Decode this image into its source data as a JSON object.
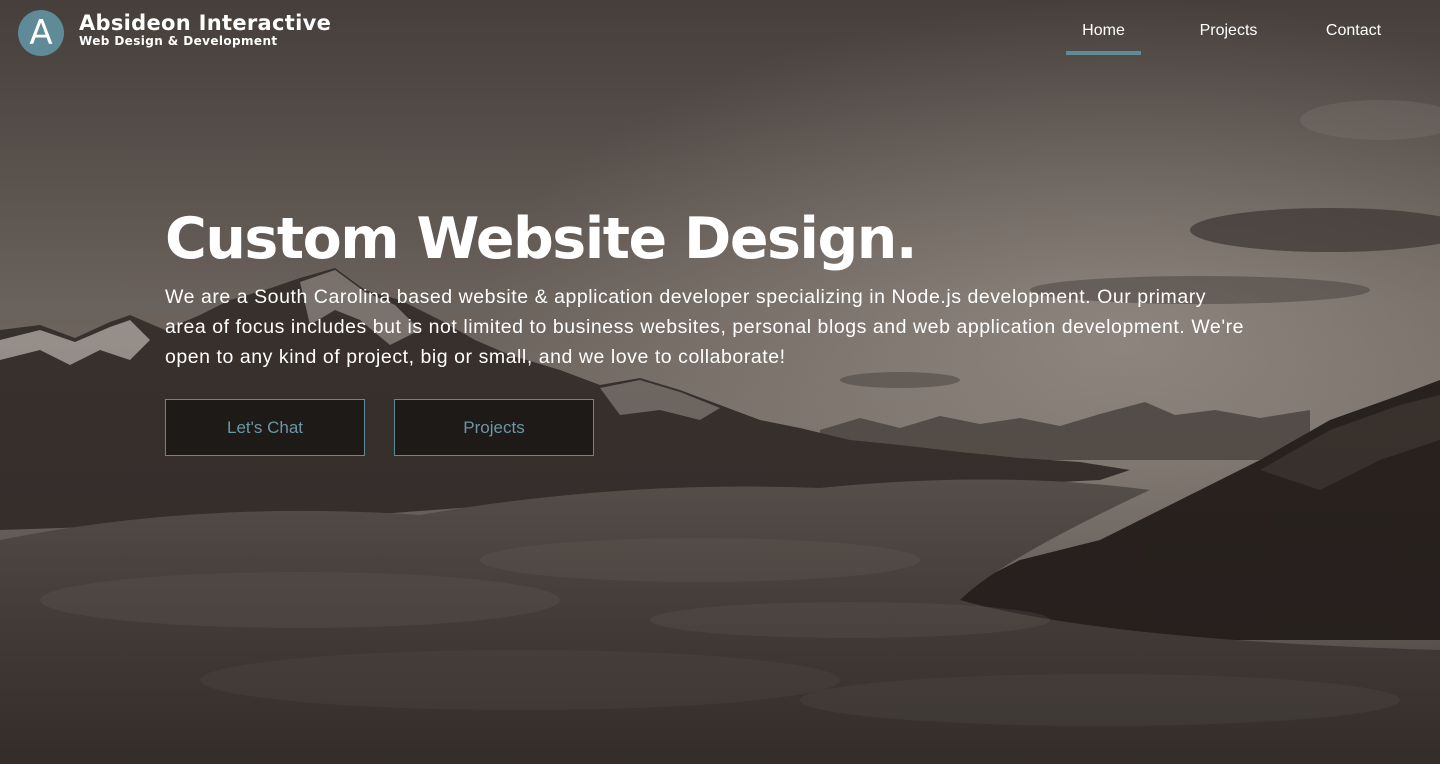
{
  "brand": {
    "logo_letter": "A",
    "name": "Absideon Interactive",
    "tagline": "Web Design & Development",
    "accent_color": "#5f8b98"
  },
  "nav": {
    "items": [
      {
        "label": "Home",
        "active": true
      },
      {
        "label": "Projects",
        "active": false
      },
      {
        "label": "Contact",
        "active": false
      }
    ]
  },
  "hero": {
    "title": "Custom Website Design.",
    "description": "We are a South Carolina based website & application developer specializing in Node.js development. Our primary area of focus includes but is not limited to business websites, personal blogs and web application development. We're open to any kind of project, big or small, and we love to collaborate!",
    "primary_button": "Let's Chat",
    "secondary_button": "Projects",
    "background": "mountain-peaks-above-clouds-image"
  }
}
